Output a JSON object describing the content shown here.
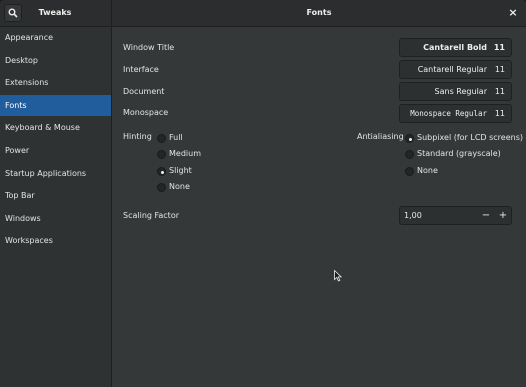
{
  "header": {
    "app_title": "Tweaks",
    "page_title": "Fonts",
    "search_icon": "search-icon",
    "close_label": "×"
  },
  "sidebar": {
    "items": [
      {
        "label": "Appearance"
      },
      {
        "label": "Desktop"
      },
      {
        "label": "Extensions"
      },
      {
        "label": "Fonts",
        "selected": true
      },
      {
        "label": "Keyboard & Mouse"
      },
      {
        "label": "Power"
      },
      {
        "label": "Startup Applications"
      },
      {
        "label": "Top Bar"
      },
      {
        "label": "Windows"
      },
      {
        "label": "Workspaces"
      }
    ]
  },
  "fonts": {
    "window_title": {
      "label": "Window Title",
      "font": "Cantarell Bold",
      "size": "11"
    },
    "interface": {
      "label": "Interface",
      "font": "Cantarell Regular",
      "size": "11"
    },
    "document": {
      "label": "Document",
      "font": "Sans Regular",
      "size": "11"
    },
    "monospace": {
      "label": "Monospace",
      "font": "Monospace Regular",
      "size": "11"
    }
  },
  "hinting": {
    "label": "Hinting",
    "options": [
      "Full",
      "Medium",
      "Slight",
      "None"
    ],
    "selected": "Slight"
  },
  "antialiasing": {
    "label": "Antialiasing",
    "options": [
      "Subpixel (for LCD screens)",
      "Standard (grayscale)",
      "None"
    ],
    "selected": "Subpixel (for LCD screens)"
  },
  "scaling": {
    "label": "Scaling Factor",
    "value": "1,00",
    "minus_label": "−",
    "plus_label": "+"
  },
  "colors": {
    "accent": "#215d9c",
    "window_bg": "#353839",
    "sidebar_bg": "#2f3233",
    "headerbar_bg": "#2b2d2e"
  }
}
